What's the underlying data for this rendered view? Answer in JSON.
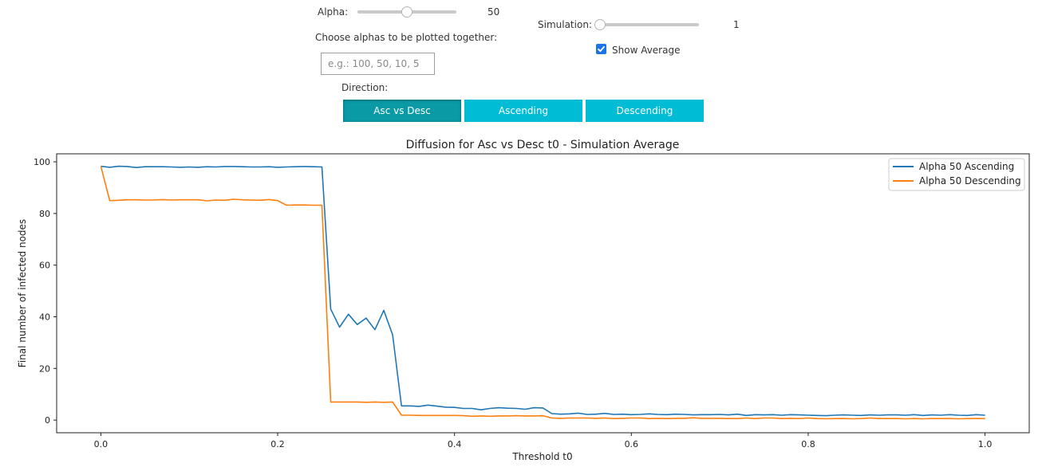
{
  "controls": {
    "alpha_label": "Alpha:",
    "alpha_value": "50",
    "alpha_fraction": 0.5,
    "simulation_label": "Simulation:",
    "simulation_value": "1",
    "simulation_fraction": 0.0,
    "alphas_prompt": "Choose alphas to be plotted together:",
    "alphas_placeholder": "e.g.: 100, 50, 10, 5",
    "show_average_label": "Show Average",
    "show_average_checked": true,
    "direction_label": "Direction:",
    "direction_buttons": [
      "Asc vs Desc",
      "Ascending",
      "Descending"
    ],
    "direction_selected": "Asc vs Desc",
    "colors": {
      "active_button": "#0a9aa6",
      "button": "#00bcd4",
      "checkbox": "#1a73e8"
    }
  },
  "chart_data": {
    "type": "line",
    "title": "Diffusion for Asc vs Desc t0 - Simulation Average",
    "xlabel": "Threshold t0",
    "ylabel": "Final number of infected nodes",
    "xlim": [
      -0.05,
      1.05
    ],
    "ylim": [
      -4.9,
      103.1
    ],
    "xticks": [
      "0.0",
      "0.2",
      "0.4",
      "0.6",
      "0.8",
      "1.0"
    ],
    "yticks": [
      "0",
      "20",
      "40",
      "60",
      "80",
      "100"
    ],
    "grid": false,
    "legend_position": "top-right",
    "x": [
      0.0,
      0.01,
      0.02,
      0.03,
      0.04,
      0.05,
      0.06,
      0.07,
      0.08,
      0.09,
      0.1,
      0.11,
      0.12,
      0.13,
      0.14,
      0.15,
      0.16,
      0.17,
      0.18,
      0.19,
      0.2,
      0.21,
      0.22,
      0.23,
      0.24,
      0.25,
      0.26,
      0.27,
      0.28,
      0.29,
      0.3,
      0.31,
      0.32,
      0.33,
      0.34,
      0.35,
      0.36,
      0.37,
      0.38,
      0.39,
      0.4,
      0.41,
      0.42,
      0.43,
      0.44,
      0.45,
      0.46,
      0.47,
      0.48,
      0.49,
      0.5,
      0.51,
      0.52,
      0.53,
      0.54,
      0.55,
      0.56,
      0.57,
      0.58,
      0.59,
      0.6,
      0.61,
      0.62,
      0.63,
      0.64,
      0.65,
      0.66,
      0.67,
      0.68,
      0.69,
      0.7,
      0.71,
      0.72,
      0.73,
      0.74,
      0.75,
      0.76,
      0.77,
      0.78,
      0.79,
      0.8,
      0.81,
      0.82,
      0.83,
      0.84,
      0.85,
      0.86,
      0.87,
      0.88,
      0.89,
      0.9,
      0.91,
      0.92,
      0.93,
      0.94,
      0.95,
      0.96,
      0.97,
      0.98,
      0.99,
      1.0
    ],
    "series": [
      {
        "name": "Alpha 50 Ascending",
        "color": "#1f77b4",
        "values": [
          98.3,
          97.9,
          98.3,
          98.2,
          97.8,
          98.1,
          98.1,
          98.1,
          98.0,
          97.9,
          98.0,
          97.9,
          98.1,
          98.0,
          98.2,
          98.2,
          98.1,
          98.0,
          98.0,
          98.1,
          97.9,
          98.0,
          98.1,
          98.2,
          98.1,
          98.0,
          43.0,
          36.0,
          41.0,
          37.0,
          39.5,
          35.0,
          42.5,
          33.0,
          5.5,
          5.5,
          5.3,
          5.8,
          5.4,
          5.0,
          4.9,
          4.5,
          4.5,
          4.0,
          4.5,
          4.8,
          4.6,
          4.5,
          4.2,
          4.8,
          4.7,
          2.5,
          2.3,
          2.4,
          2.7,
          2.2,
          2.3,
          2.6,
          2.2,
          2.3,
          2.1,
          2.2,
          2.4,
          2.2,
          2.1,
          2.3,
          2.2,
          2.0,
          2.1,
          2.1,
          2.2,
          2.0,
          2.3,
          1.8,
          2.1,
          2.0,
          2.1,
          1.9,
          2.1,
          2.0,
          1.9,
          1.8,
          1.7,
          1.9,
          2.0,
          1.9,
          1.8,
          2.0,
          1.9,
          2.0,
          2.0,
          1.9,
          2.1,
          1.8,
          2.0,
          1.9,
          2.1,
          1.9,
          1.8,
          2.1,
          1.9
        ]
      },
      {
        "name": "Alpha 50 Descending",
        "color": "#ff7f0e",
        "values": [
          98.3,
          85.0,
          85.1,
          85.3,
          85.3,
          85.2,
          85.2,
          85.4,
          85.2,
          85.3,
          85.3,
          85.3,
          84.9,
          85.2,
          85.1,
          85.5,
          85.3,
          85.2,
          85.1,
          85.4,
          85.0,
          83.2,
          83.3,
          83.3,
          83.2,
          83.2,
          7.0,
          7.0,
          7.0,
          7.0,
          6.9,
          7.0,
          6.9,
          7.0,
          1.9,
          1.9,
          1.8,
          1.8,
          1.8,
          1.8,
          1.8,
          1.7,
          1.5,
          1.6,
          1.5,
          1.6,
          1.6,
          1.7,
          1.6,
          1.6,
          1.7,
          0.8,
          0.7,
          0.8,
          0.8,
          0.8,
          0.7,
          0.8,
          0.6,
          0.7,
          0.8,
          0.8,
          0.6,
          0.7,
          0.6,
          0.7,
          0.7,
          0.9,
          0.7,
          0.7,
          0.7,
          0.6,
          0.6,
          0.8,
          0.6,
          0.8,
          0.8,
          0.6,
          0.7,
          0.6,
          0.8,
          0.6,
          0.5,
          0.6,
          0.6,
          0.5,
          0.6,
          0.8,
          0.6,
          0.6,
          0.6,
          0.5,
          0.6,
          0.5,
          0.6,
          0.6,
          0.6,
          0.5,
          0.6,
          0.6,
          0.6
        ]
      }
    ]
  }
}
